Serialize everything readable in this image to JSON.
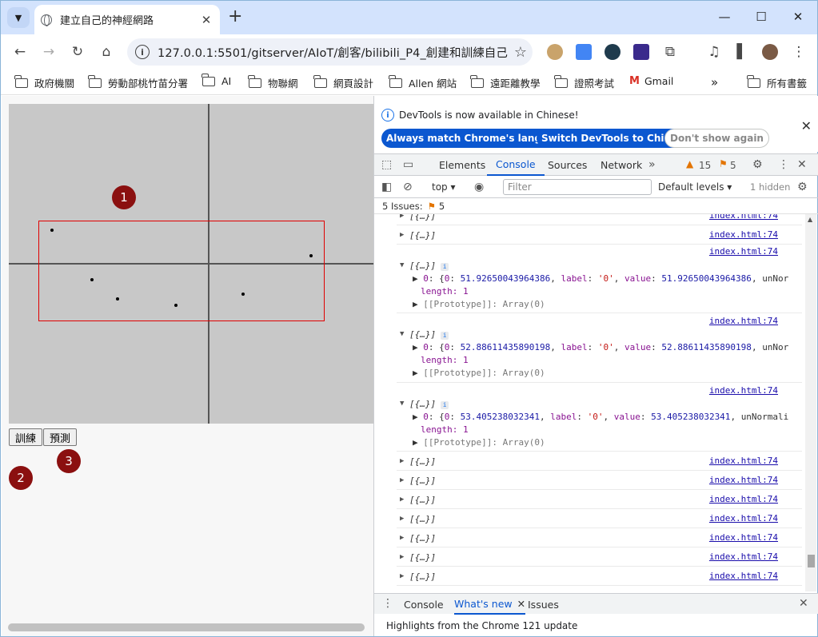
{
  "browser": {
    "tab_title": "建立自己的神經網路",
    "url": "127.0.0.1:5501/gitserver/AIoT/創客/bilibili_P4_創建和訓練自己的...",
    "bookmarks": [
      "政府機關",
      "勞動部桃竹苗分署",
      "AI",
      "物聯網",
      "網頁設計",
      "Allen 網站",
      "遠距離教學",
      "證照考試",
      "Gmail",
      "所有書籤"
    ],
    "overflow_label": "»"
  },
  "page": {
    "markers": [
      "1",
      "2",
      "3"
    ],
    "buttons": {
      "train": "訓練",
      "predict": "預測"
    },
    "points": [
      {
        "x": -0.86,
        "y": 0.21
      },
      {
        "x": -0.64,
        "y": -0.1
      },
      {
        "x": -0.5,
        "y": -0.22
      },
      {
        "x": -0.18,
        "y": -0.26
      },
      {
        "x": 0.19,
        "y": -0.19
      },
      {
        "x": 0.56,
        "y": 0.05
      }
    ]
  },
  "devtools": {
    "banner_message": "DevTools is now available in Chinese!",
    "banner_buttons": [
      "Always match Chrome's language",
      "Switch DevTools to Chinese",
      "Don't show again"
    ],
    "tabs": [
      "Elements",
      "Console",
      "Sources",
      "Network"
    ],
    "active_tab": "Console",
    "warnings": "15",
    "errors": "5",
    "context": "top",
    "filter_placeholder": "Filter",
    "levels": "Default levels",
    "hidden": "1 hidden",
    "issues_label": "5 Issues:",
    "issues_count": "5",
    "source": "index.html:74",
    "collapsed_label": "[{…}]",
    "expanded": [
      {
        "value": "51.92650043964386",
        "tail": "unNor"
      },
      {
        "value": "52.88611435890198",
        "tail": "unNor"
      },
      {
        "value": "53.405238032341",
        "tail": "unNormali"
      }
    ],
    "length_label": "length: 1",
    "proto_label": "[[Prototype]]: Array(0)",
    "drawer_tabs": [
      "Console",
      "What's new",
      "Issues"
    ],
    "drawer_active": "What's new",
    "highlights": "Highlights from the Chrome 121 update"
  }
}
